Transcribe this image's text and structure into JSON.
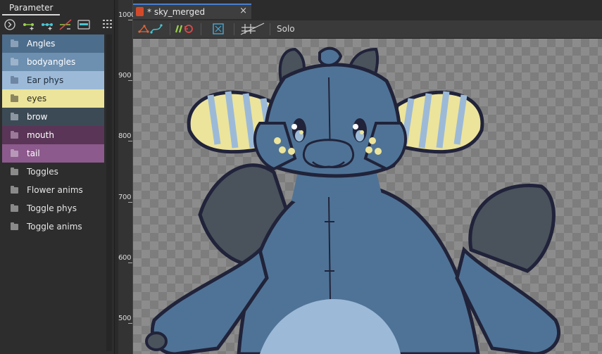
{
  "panel": {
    "tab_label": "Parameter",
    "items": [
      {
        "label": "Angles",
        "bg": "#4d6d8c",
        "text": "#ffffff",
        "folder": "#8aa0b8"
      },
      {
        "label": "bodyangles",
        "bg": "#6d8fb0",
        "text": "#ffffff",
        "folder": "#9db3cb"
      },
      {
        "label": "Ear phys",
        "bg": "#9cbad8",
        "text": "#1e2a38",
        "folder": "#6e86a3"
      },
      {
        "label": "eyes",
        "bg": "#ece49b",
        "text": "#2a2a1e",
        "folder": "#8c8660"
      },
      {
        "label": "brow",
        "bg": "#3c4a55",
        "text": "#ffffff",
        "folder": "#8a97a3"
      },
      {
        "label": "mouth",
        "bg": "#5a3557",
        "text": "#ffffff",
        "folder": "#9a7a98"
      },
      {
        "label": "tail",
        "bg": "#8c5a8c",
        "text": "#ffffff",
        "folder": "#b898b8"
      },
      {
        "label": "Toggles",
        "bg": "#2d2d2d",
        "text": "#e6e6e6",
        "folder": "#8a8a8a"
      },
      {
        "label": "Flower anims",
        "bg": "#2d2d2d",
        "text": "#e6e6e6",
        "folder": "#8a8a8a"
      },
      {
        "label": "Toggle phys",
        "bg": "#2d2d2d",
        "text": "#e6e6e6",
        "folder": "#8a8a8a"
      },
      {
        "label": "Toggle anims",
        "bg": "#2d2d2d",
        "text": "#e6e6e6",
        "folder": "#8a8a8a"
      }
    ]
  },
  "ruler": {
    "labels": [
      "1000",
      "900",
      "800",
      "700",
      "600",
      "500"
    ]
  },
  "document": {
    "tab_title": "* sky_merged",
    "close_glyph": "×"
  },
  "view_toolbar": {
    "solo_label": "Solo"
  }
}
